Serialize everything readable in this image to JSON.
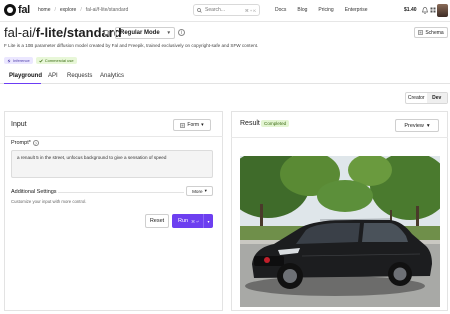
{
  "nav": {
    "logo": "fal",
    "breadcrumb": [
      "home",
      "explore",
      "fal-ai/f-lite/standard"
    ],
    "search": {
      "placeholder": "Search...",
      "shortcut": "⌘ + K"
    },
    "links": [
      "Docs",
      "Blog",
      "Pricing",
      "Enterprise"
    ],
    "credit": "$1.40"
  },
  "model": {
    "owner": "fal-ai/",
    "name": "f-lite/standard",
    "mode": "Regular Mode",
    "description": "F Lite is a 10B parameter diffusion model created by Fal and Freepik, trained exclusively on copyright-safe and SFW content.",
    "badges": [
      "Inference",
      "Commercial use"
    ],
    "schema_label": "Schema"
  },
  "tabs": [
    "Playground",
    "API",
    "Requests",
    "Analytics"
  ],
  "view_toggle": [
    "Creator",
    "Dev"
  ],
  "input": {
    "title": "Input",
    "form_label": "Form",
    "prompt_label": "Prompt*",
    "prompt_value": "a renault 5 in the street, unfocus background to give a sensation of speed",
    "additional_title": "Additional Settings",
    "more_label": "More",
    "additional_desc": "Customize your input with more control.",
    "reset_label": "Reset",
    "run_label": "Run",
    "run_shortcut": "⌘ ↵"
  },
  "result": {
    "title": "Result",
    "status": "Completed",
    "preview_label": "Preview"
  },
  "colors": {
    "accent": "#6d3ff0",
    "completed_bg": "#e3f5d2",
    "completed_fg": "#3d6b16"
  }
}
